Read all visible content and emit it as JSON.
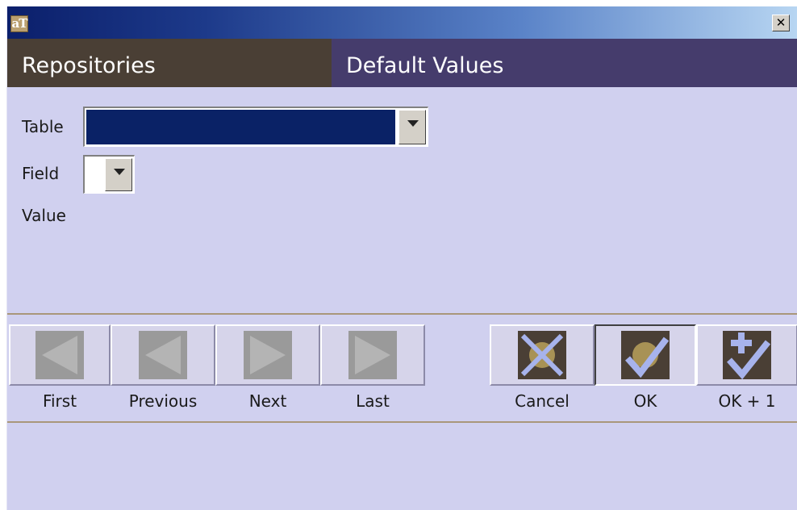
{
  "titlebar": {
    "logo_text": "aT",
    "close_label": "✕"
  },
  "header": {
    "left_title": "Repositories",
    "right_title": "Default Values"
  },
  "form": {
    "table_label": "Table",
    "field_label": "Field",
    "value_label": "Value",
    "table_selected_value": "",
    "field_selected_value": ""
  },
  "nav": {
    "first": "First",
    "previous": "Previous",
    "next": "Next",
    "last": "Last"
  },
  "actions": {
    "cancel": "Cancel",
    "ok": "OK",
    "ok_plus_one": "OK + 1"
  },
  "colors": {
    "window_bg": "#d0d0ef",
    "header_left": "#4a3f35",
    "header_right": "#453c6c",
    "table_selection": "#0a2266",
    "disabled_arrow": "#9a9a9a",
    "action_icon_bg": "#4a3f35",
    "action_icon_mark": "#a7b3ec"
  },
  "icons": [
    "app-logo",
    "close-icon",
    "chevron-down-icon",
    "first-icon",
    "previous-icon",
    "next-icon",
    "last-icon",
    "cancel-icon",
    "ok-icon",
    "ok-plus-one-icon"
  ]
}
